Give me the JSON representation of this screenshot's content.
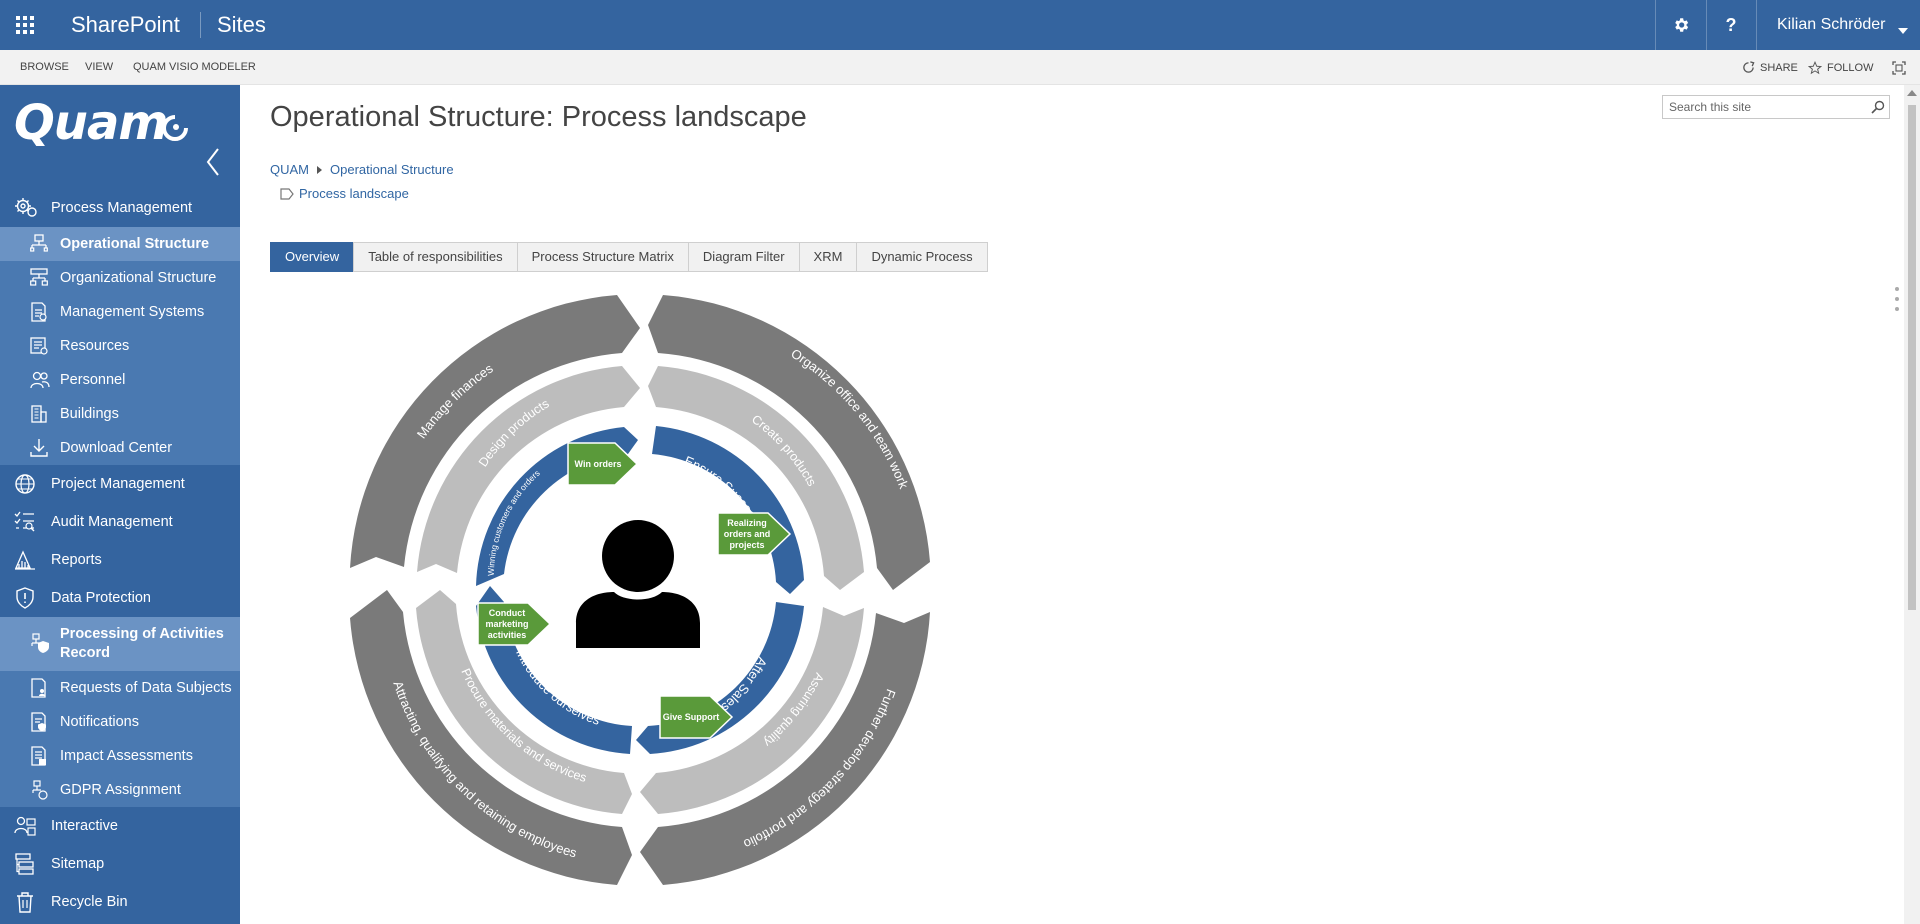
{
  "suitebar": {
    "app_name": "SharePoint",
    "section": "Sites",
    "user_name": "Kilian Schröder",
    "help_label": "?",
    "bg_color": "#34649f"
  },
  "ribbon": {
    "tabs": [
      "BROWSE",
      "VIEW",
      "QUAM VISIO MODELER"
    ],
    "share_label": "SHARE",
    "follow_label": "FOLLOW"
  },
  "leftnav": {
    "logo_text": "Quam",
    "items": [
      {
        "label": "Process Management",
        "icon": "process-gear-icon"
      },
      {
        "label": "Operational Structure",
        "icon": "operational-structure-icon"
      },
      {
        "label": "Organizational Structure",
        "icon": "org-chart-icon"
      },
      {
        "label": "Management Systems",
        "icon": "management-systems-icon"
      },
      {
        "label": "Resources",
        "icon": "resources-icon"
      },
      {
        "label": "Personnel",
        "icon": "personnel-icon"
      },
      {
        "label": "Buildings",
        "icon": "buildings-icon"
      },
      {
        "label": "Download Center",
        "icon": "download-icon"
      },
      {
        "label": "Project Management",
        "icon": "globe-icon"
      },
      {
        "label": "Audit Management",
        "icon": "audit-checklist-icon"
      },
      {
        "label": "Reports",
        "icon": "reports-chart-icon"
      },
      {
        "label": "Data Protection",
        "icon": "shield-icon"
      },
      {
        "label": "Processing of Activities Record",
        "icon": "processing-shield-icon"
      },
      {
        "label": "Requests of Data Subjects",
        "icon": "request-icon"
      },
      {
        "label": "Notifications",
        "icon": "notification-icon"
      },
      {
        "label": "Impact Assessments",
        "icon": "assessment-icon"
      },
      {
        "label": "GDPR Assignment",
        "icon": "gdpr-icon"
      },
      {
        "label": "Interactive",
        "icon": "interactive-icon"
      },
      {
        "label": "Sitemap",
        "icon": "sitemap-icon"
      },
      {
        "label": "Recycle Bin",
        "icon": "recycle-bin-icon"
      }
    ]
  },
  "main": {
    "title": "Operational Structure: Process landscape",
    "breadcrumb": [
      "QUAM",
      "Operational Structure"
    ],
    "current_page": "Process landscape",
    "search_placeholder": "Search this site",
    "tabs": [
      "Overview",
      "Table of responsibilities",
      "Process Structure Matrix",
      "Diagram Filter",
      "XRM",
      "Dynamic Process"
    ]
  },
  "diagram": {
    "outer_ring": [
      "Manage finances",
      "Organize office and team work",
      "Further develop strategy and portfolio",
      "Attracting, qualifying and retaining employees"
    ],
    "middle_ring": [
      "Design products",
      "Create products",
      "Assuring quality",
      "Procure materials and services"
    ],
    "inner_ring": [
      "Winning customers and orders",
      "Ensure Succes",
      "After Sales",
      "Introduce ourselves"
    ],
    "boxes": [
      "Win orders",
      "Realizing orders and projects",
      "Give Support",
      "Conduct marketing activities"
    ],
    "colors": {
      "outer": "#7a7a7a",
      "middle": "#bdbdbd",
      "inner": "#34649f",
      "box": "#5a9a3a"
    }
  }
}
